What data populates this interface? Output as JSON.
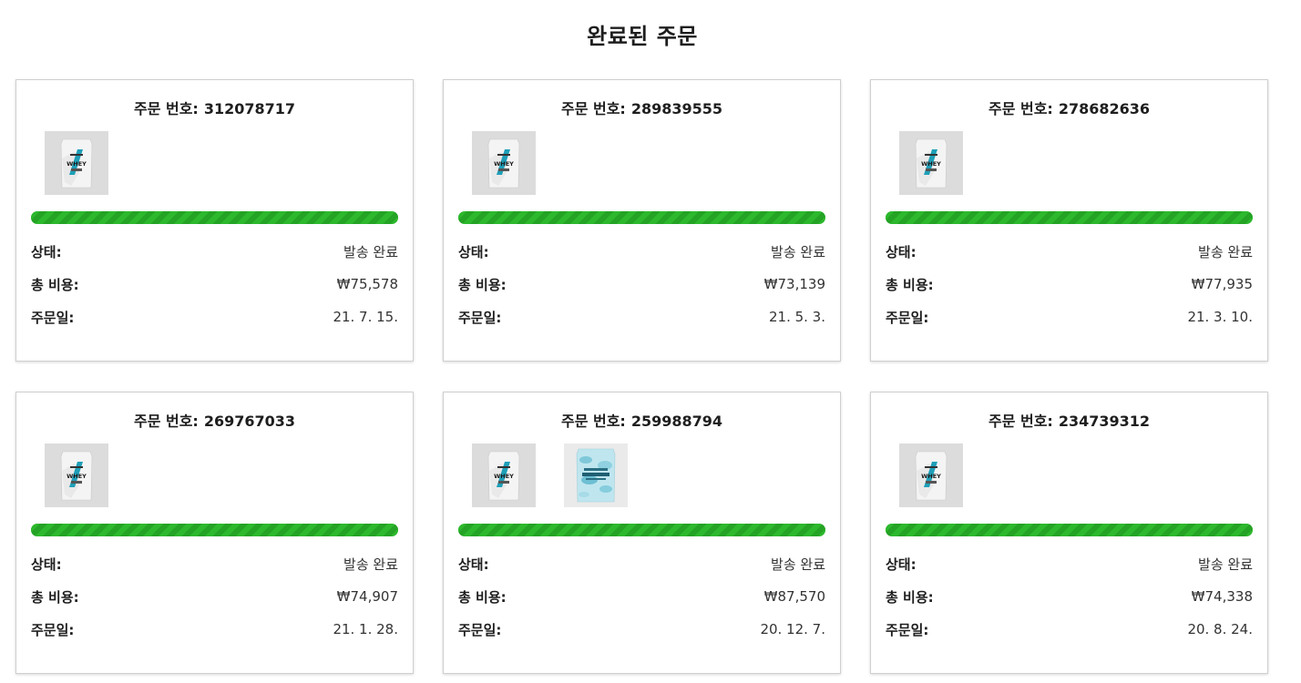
{
  "page": {
    "title": "완료된 주문"
  },
  "labels": {
    "order_number": "주문 번호:",
    "status": "상태:",
    "total": "총 비용:",
    "date": "주문일:"
  },
  "colors": {
    "progress": "#2db82d",
    "thumb_bg": "#dcdcdc"
  },
  "orders": [
    {
      "number": "312078717",
      "status": "발송 완료",
      "total": "₩75,578",
      "date": "21. 7. 15.",
      "progress": 1.0,
      "products": [
        {
          "icon": "whey-protein-pouch-icon"
        }
      ]
    },
    {
      "number": "289839555",
      "status": "발송 완료",
      "total": "₩73,139",
      "date": "21. 5. 3.",
      "progress": 1.0,
      "products": [
        {
          "icon": "whey-protein-pouch-icon"
        }
      ]
    },
    {
      "number": "278682636",
      "status": "발송 완료",
      "total": "₩77,935",
      "date": "21. 3. 10.",
      "progress": 1.0,
      "products": [
        {
          "icon": "whey-protein-pouch-icon"
        }
      ]
    },
    {
      "number": "269767033",
      "status": "발송 완료",
      "total": "₩74,907",
      "date": "21. 1. 28.",
      "progress": 1.0,
      "products": [
        {
          "icon": "whey-protein-pouch-icon"
        }
      ]
    },
    {
      "number": "259988794",
      "status": "발송 완료",
      "total": "₩87,570",
      "date": "20. 12. 7.",
      "progress": 1.0,
      "products": [
        {
          "icon": "whey-protein-pouch-icon"
        },
        {
          "icon": "camo-whey-pouch-icon"
        }
      ]
    },
    {
      "number": "234739312",
      "status": "발송 완료",
      "total": "₩74,338",
      "date": "20. 8. 24.",
      "progress": 1.0,
      "products": [
        {
          "icon": "whey-protein-pouch-icon"
        }
      ]
    }
  ]
}
